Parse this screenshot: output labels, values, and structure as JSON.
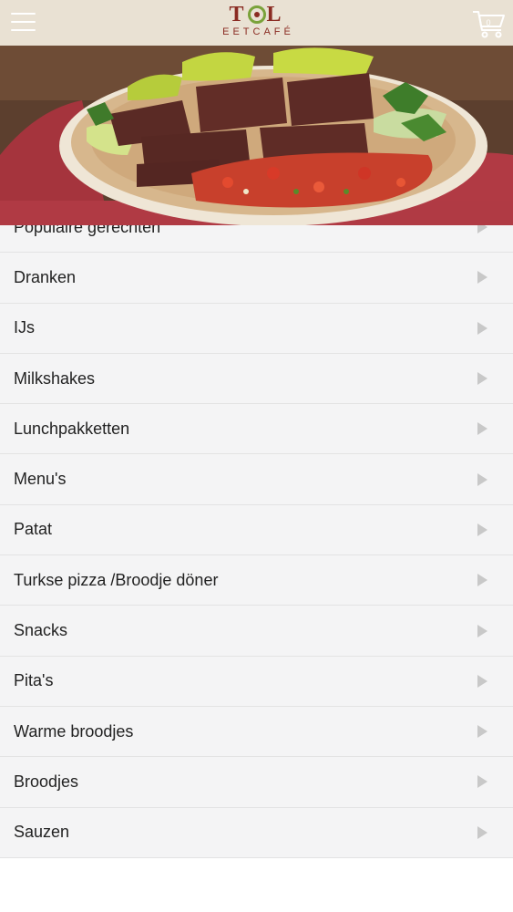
{
  "header": {
    "logo_text": "TOL",
    "logo_subtitle": "EETCAFÉ",
    "cart_count": "0"
  },
  "categories": [
    {
      "label": "Populaire gerechten"
    },
    {
      "label": "Dranken"
    },
    {
      "label": "IJs"
    },
    {
      "label": "Milkshakes"
    },
    {
      "label": "Lunchpakketten"
    },
    {
      "label": "Menu's"
    },
    {
      "label": "Patat"
    },
    {
      "label": "Turkse pizza /Broodje döner"
    },
    {
      "label": "Snacks"
    },
    {
      "label": "Pita's"
    },
    {
      "label": "Warme broodjes"
    },
    {
      "label": "Broodjes"
    },
    {
      "label": "Sauzen"
    }
  ],
  "colors": {
    "header_bg": "#e9e1d3",
    "brand": "#8a2b22",
    "brand_green": "#7aa23a",
    "row_bg": "#f4f4f5"
  }
}
